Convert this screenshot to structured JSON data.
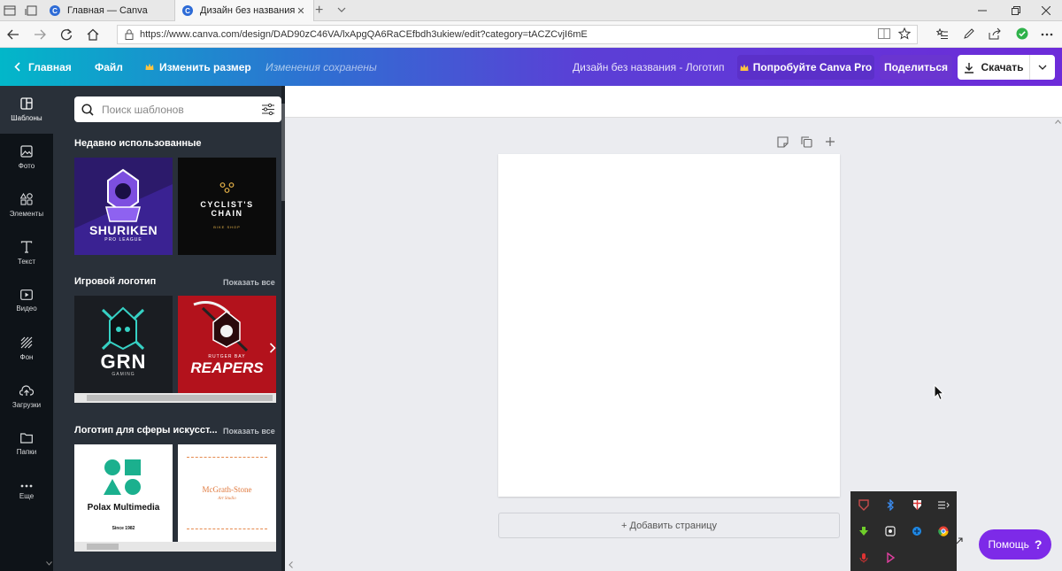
{
  "browser": {
    "tabs": [
      {
        "title": "Главная — Canva",
        "favicon_letter": "C",
        "active": false
      },
      {
        "title": "Дизайн без названия –",
        "favicon_letter": "C",
        "active": true
      }
    ],
    "new_tab_symbol": "+",
    "url": "https://www.canva.com/design/DAD90zC46VA/lxApgQA6RaCEfbdh3ukiew/edit?category=tACZCvjI6mE"
  },
  "header": {
    "home_label": "Главная",
    "file_label": "Файл",
    "resize_label": "Изменить размер",
    "saved_status": "Изменения сохранены",
    "design_title": "Дизайн без названия - Логотип",
    "try_pro_label": "Попробуйте Canva Pro",
    "share_label": "Поделиться",
    "download_label": "Скачать",
    "colors": {
      "pro_button": "#5b30c9",
      "share_button": "#6a35d0",
      "download_button": "#ffffff"
    }
  },
  "left_nav": {
    "items": [
      {
        "label": "Шаблоны",
        "icon": "templates-icon",
        "selected": true
      },
      {
        "label": "Фото",
        "icon": "photo-icon",
        "selected": false
      },
      {
        "label": "Элементы",
        "icon": "elements-icon",
        "selected": false
      },
      {
        "label": "Текст",
        "icon": "text-icon",
        "selected": false
      },
      {
        "label": "Видео",
        "icon": "video-icon",
        "selected": false
      },
      {
        "label": "Фон",
        "icon": "background-icon",
        "selected": false
      },
      {
        "label": "Загрузки",
        "icon": "upload-icon",
        "selected": false
      },
      {
        "label": "Папки",
        "icon": "folder-icon",
        "selected": false
      },
      {
        "label": "Еще",
        "icon": "more-icon",
        "selected": false
      }
    ]
  },
  "panel": {
    "search_placeholder": "Поиск шаблонов",
    "recent_title": "Недавно использованные",
    "recent_templates": [
      {
        "title": "SHURIKEN",
        "subtitle": "PRO LEAGUE",
        "bg": "#2c1a6b"
      },
      {
        "title": "CYCLIST'S CHAIN",
        "subtitle": "BIKE SHOP",
        "bg": "#0b0b0b"
      }
    ],
    "gaming_title": "Игровой логотип",
    "gaming_show_all": "Показать все",
    "gaming_templates": [
      {
        "title": "GRN",
        "subtitle": "GAMING",
        "bg": "#1a1d22"
      },
      {
        "title": "REAPERS",
        "subtitle": "RUTGER BAY",
        "bg": "#b3121c"
      }
    ],
    "art_title": "Логотип для сферы искусст...",
    "art_show_all": "Показать все",
    "art_templates": [
      {
        "title": "Polax Multimedia",
        "subtitle": "Since 1982",
        "bg": "#ffffff"
      },
      {
        "title": "McGrath-Stone",
        "subtitle": "Art Studio",
        "bg": "#ffffff"
      }
    ]
  },
  "canvas": {
    "add_page_label": "+ Добавить страницу",
    "toolbar_icons": [
      "note-icon",
      "duplicate-icon",
      "add-icon"
    ]
  },
  "help": {
    "label": "Помощь",
    "symbol": "?"
  },
  "tray": {
    "icons": [
      "shield-icon",
      "bluetooth-icon",
      "security-icon",
      "network-icon",
      "download-icon",
      "settings-icon",
      "app-icon",
      "chrome-icon",
      "mic-icon",
      "pen-icon"
    ]
  }
}
